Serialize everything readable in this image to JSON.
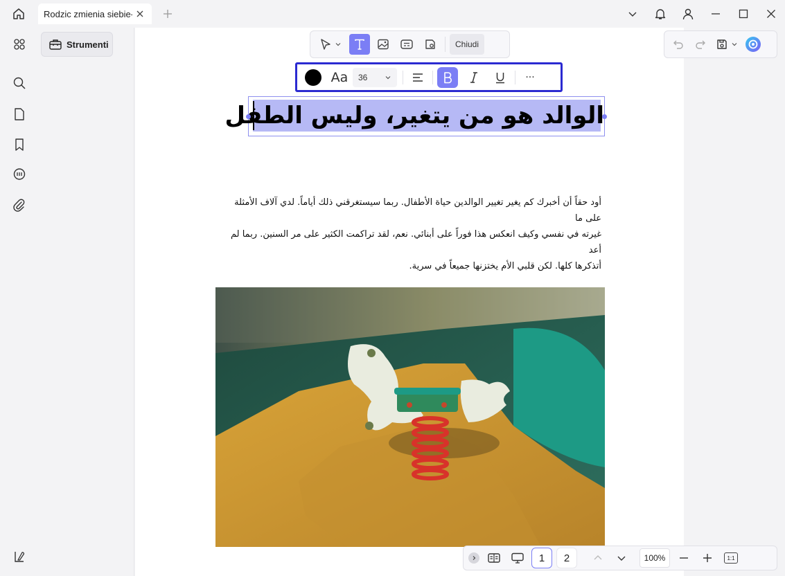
{
  "tabbar": {
    "tab_title": "Rodzic zmienia siebie-ar"
  },
  "toolpanel": {
    "strumenti_label": "Strumenti"
  },
  "edit_toolbar": {
    "close_label": "Chiudi"
  },
  "format_toolbar": {
    "text_color": "#000000",
    "font_label": "Aa",
    "font_size": "36",
    "more_label": "···"
  },
  "document": {
    "title": "الوالد هو من يتغير، وليس الطفل",
    "paragraph_lines": [
      "أود حقاً أن أخبرك كم يغير تغيير الوالدين حياة الأطفال. ربما سيستغرقني ذلك أياماً. لدي آلاف الأمثلة على ما",
      "غيرته في نفسي وكيف انعكس هذا فوراً على أبنائي. نعم، لقد تراكمت الكثير على مر السنين. ربما لم أعد",
      "أتذكرها كلها. لكن قلبي الأم يختزنها جميعاً في سرية."
    ]
  },
  "bottom_nav": {
    "pages": [
      "1",
      "2"
    ],
    "current_page": "1",
    "zoom": "100%",
    "fit_label": "1:1"
  },
  "colors": {
    "accent": "#7b7ef5",
    "format_toolbar_border": "#2b2ad1",
    "selection": "#b6b9f5"
  }
}
